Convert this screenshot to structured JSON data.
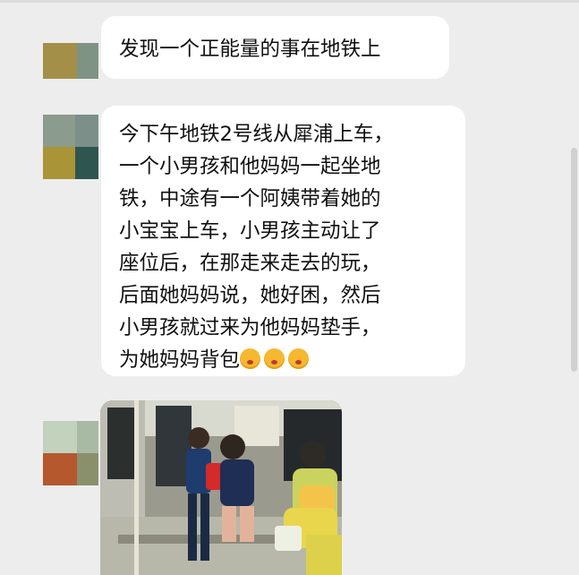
{
  "colors": {
    "background": "#ededed",
    "bubble": "#ffffff",
    "text": "#111111"
  },
  "messages": [
    {
      "sender": "avatar-1",
      "type": "text",
      "lines": [
        "发现一个正能量的事在地铁上"
      ]
    },
    {
      "sender": "avatar-2",
      "type": "text",
      "lines": [
        "今下午地铁2号线从犀浦上车，",
        "一个小男孩和他妈妈一起坐地",
        "铁，中途有一个阿姨带着她的",
        "小宝宝上车，小男孩主动让了",
        "座位后，在那走来走去的玩，",
        "后面她妈妈说，她好困，然后",
        "小男孩就过来为他妈妈垫手，",
        "为她妈妈背包"
      ],
      "trailing_emoji": [
        "flushed-face-icon",
        "flushed-face-icon",
        "flushed-face-icon"
      ]
    },
    {
      "sender": "avatar-3",
      "type": "image",
      "content": "photo of a boy standing next to his mother on a subway train"
    }
  ]
}
